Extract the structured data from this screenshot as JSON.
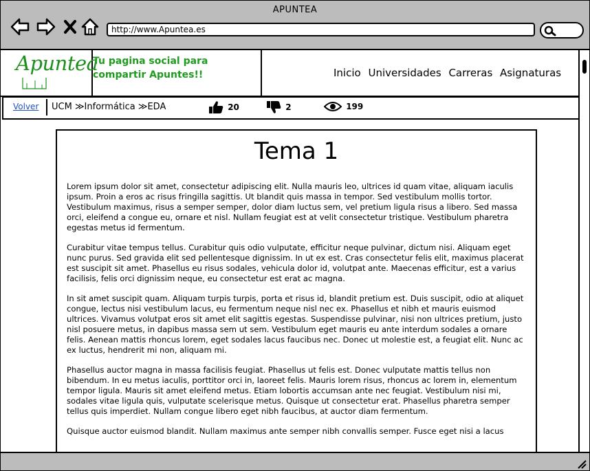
{
  "window": {
    "title": "APUNTEA"
  },
  "browser": {
    "url": "http://www.Apuntea.es"
  },
  "header": {
    "logo": "Apuntea",
    "slogan": "Tu pagina social para compartir Apuntes!!",
    "nav": [
      "Inicio",
      "Universidades",
      "Carreras",
      "Asignaturas"
    ]
  },
  "subbar": {
    "back_label": "Volver",
    "breadcrumb": "UCM ≫Informática ≫EDA",
    "likes": "20",
    "dislikes": "2",
    "views": "199"
  },
  "document": {
    "title": "Tema 1",
    "paragraphs": [
      "Lorem ipsum dolor sit amet, consectetur adipiscing elit. Nulla mauris leo, ultrices id quam vitae, aliquam iaculis ipsum. Proin a eros ac risus fringilla sagittis. Ut blandit quis massa in tempor. Sed vestibulum mollis tortor. Vestibulum maximus, risus a semper semper, dolor diam luctus sem, vel pretium ligula risus a libero. Sed massa orci, eleifend a congue eu, ornare et nisl. Nullam feugiat est at velit consectetur tristique. Vestibulum pharetra egestas metus id fermentum.",
      "Curabitur vitae tempus tellus. Curabitur quis odio vulputate, efficitur neque pulvinar, dictum nisi. Aliquam eget nunc purus. Sed gravida elit sed pellentesque dignissim. In ut ex est. Cras consectetur felis elit, maximus placerat est suscipit sit amet. Phasellus eu risus sodales, vehicula dolor id, volutpat ante. Maecenas efficitur, est a varius facilisis, felis orci dignissim neque, eu consectetur est erat ac magna.",
      "In sit amet suscipit quam. Aliquam turpis turpis, porta et risus id, blandit pretium est. Duis suscipit, odio at aliquet congue, lectus nisi vestibulum lacus, eu fermentum neque nisl nec ex. Phasellus et nibh et mauris euismod ultrices. Vivamus volutpat eros sit amet elit sagittis egestas. Suspendisse pulvinar, nisi non ultrices pretium, justo nisl posuere metus, in dapibus massa sem ut sem. Vestibulum eget mauris eu ante interdum sodales a ornare felis. Aenean mattis rhoncus lorem, eget sodales lacus faucibus nec. Donec ut molestie est, a feugiat elit. Nunc ac ex luctus, hendrerit mi non, aliquam mi.",
      "Phasellus auctor magna in massa facilisis feugiat. Phasellus ut felis est. Donec vulputate mattis tellus non bibendum. In eu metus iaculis, porttitor orci in, laoreet felis. Mauris lorem risus, rhoncus ac lorem in, elementum tempor ligula. Mauris sit amet eleifend metus. Etiam lobortis accumsan ante nec feugiat. Vestibulum nisi mi, sodales vitae ligula quis, vulputate scelerisque metus. Quisque ut consectetur erat. Phasellus pharetra semper tellus quis imperdiet. Nullam congue libero eget nibh faucibus, at auctor diam fermentum.",
      "Quisque auctor euismod blandit. Nullam maximus ante semper nibh convallis semper. Fusce eget nisi a lacus"
    ]
  },
  "colors": {
    "chrome": "#bcbcbc",
    "logo": "#1d8f1d",
    "slogan": "#1f9c1f",
    "link": "#1f4fc7"
  },
  "icons": [
    "back-arrow-icon",
    "forward-arrow-icon",
    "close-x-icon",
    "home-icon",
    "search-icon",
    "thumbs-up-icon",
    "thumbs-down-icon",
    "eye-icon",
    "resize-grip-icon"
  ]
}
